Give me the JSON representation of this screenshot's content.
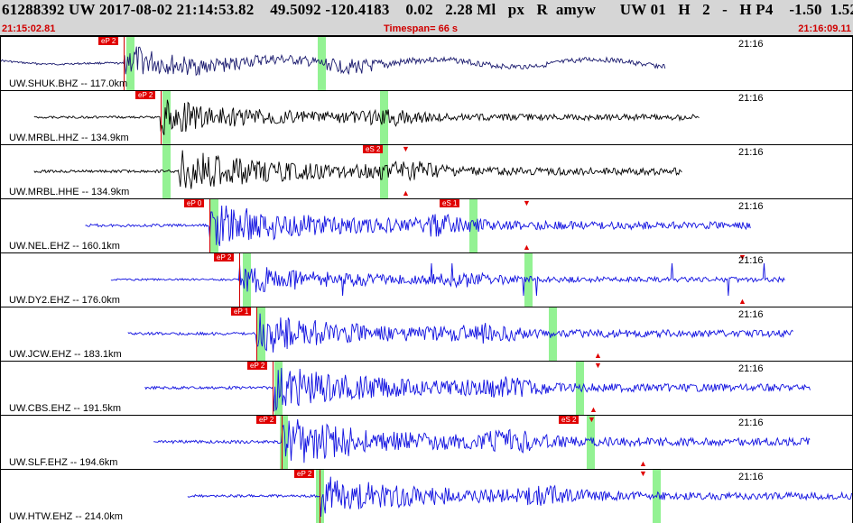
{
  "header": {
    "title": "61288392 UW 2017-08-02 21:14:53.82    49.5092 -120.4183    0.02   2.28 Ml   px   R  amyw      UW 01   H   2   -   H P4    -1.50  1.52",
    "start_time": "21:15:02.81",
    "timespan": "Timespan=  66 s",
    "end_time": "21:16:09.11"
  },
  "colors": {
    "header_bg": "#d6d6d6",
    "navy": "#1a1a6e",
    "black": "#000000",
    "blue": "#1010e0",
    "pick": "#e00000",
    "window": "#80f080"
  },
  "panels": [
    {
      "station": "UW.SHUK.BHZ -- 117.0km",
      "time_label": "21:16",
      "trace_color": "navy",
      "style": "long",
      "signal": {
        "start": 0.0,
        "end": 0.78,
        "onset": 0.145,
        "amp": 0.3
      },
      "picks": [
        {
          "label": "eP 2",
          "pos": 0.145,
          "line": true
        }
      ],
      "windows": [
        0.148,
        0.372
      ],
      "triangles": []
    },
    {
      "station": "UW.MRBL.HHZ -- 134.9km",
      "time_label": "21:16",
      "trace_color": "black",
      "style": "burst",
      "signal": {
        "start": 0.04,
        "end": 0.82,
        "onset": 0.188,
        "amp": 0.35
      },
      "picks": [
        {
          "label": "eP 2",
          "pos": 0.188,
          "line": true
        }
      ],
      "windows": [
        0.19,
        0.445
      ],
      "triangles": []
    },
    {
      "station": "UW.MRBL.HHE -- 134.9km",
      "time_label": "21:16",
      "trace_color": "black",
      "style": "burst",
      "signal": {
        "start": 0.04,
        "end": 0.8,
        "onset": 0.21,
        "amp": 0.42
      },
      "picks": [
        {
          "label": "eS 2",
          "pos": 0.455,
          "line": false
        }
      ],
      "windows": [
        0.19,
        0.445
      ],
      "triangles": [
        {
          "pos": 0.475,
          "top": true
        },
        {
          "pos": 0.475,
          "top": false
        }
      ]
    },
    {
      "station": "UW.NEL.EHZ -- 160.1km",
      "time_label": "21:16",
      "trace_color": "blue",
      "style": "burst",
      "signal": {
        "start": 0.1,
        "end": 0.88,
        "onset": 0.245,
        "amp": 0.45
      },
      "picks": [
        {
          "label": "eP 0",
          "pos": 0.245,
          "line": true
        },
        {
          "label": "eS 1",
          "pos": 0.545,
          "line": false
        }
      ],
      "windows": [
        0.247,
        0.55
      ],
      "triangles": [
        {
          "pos": 0.617,
          "top": true
        },
        {
          "pos": 0.617,
          "top": false
        }
      ]
    },
    {
      "station": "UW.DY2.EHZ -- 176.0km",
      "time_label": "21:16",
      "trace_color": "blue",
      "style": "spiky",
      "signal": {
        "start": 0.13,
        "end": 0.92,
        "onset": 0.28,
        "amp": 0.3
      },
      "picks": [
        {
          "label": "eP 2",
          "pos": 0.28,
          "line": true
        }
      ],
      "windows": [
        0.285,
        0.615
      ],
      "triangles": [
        {
          "pos": 0.87,
          "top": true
        },
        {
          "pos": 0.87,
          "top": false
        }
      ]
    },
    {
      "station": "UW.JCW.EHZ -- 183.1km",
      "time_label": "21:16",
      "trace_color": "blue",
      "style": "burst",
      "signal": {
        "start": 0.15,
        "end": 0.93,
        "onset": 0.3,
        "amp": 0.42
      },
      "picks": [
        {
          "label": "eP 1",
          "pos": 0.3,
          "line": true
        }
      ],
      "windows": [
        0.302,
        0.643
      ],
      "triangles": [
        {
          "pos": 0.7,
          "top": false
        }
      ]
    },
    {
      "station": "UW.CBS.EHZ -- 191.5km",
      "time_label": "21:16",
      "trace_color": "blue",
      "style": "burst",
      "signal": {
        "start": 0.17,
        "end": 0.95,
        "onset": 0.32,
        "amp": 0.45
      },
      "picks": [
        {
          "label": "eP 2",
          "pos": 0.32,
          "line": true
        }
      ],
      "windows": [
        0.322,
        0.675
      ],
      "triangles": [
        {
          "pos": 0.7,
          "top": true
        },
        {
          "pos": 0.695,
          "top": false
        }
      ]
    },
    {
      "station": "UW.SLF.EHZ -- 194.6km",
      "time_label": "21:16",
      "trace_color": "blue",
      "style": "burst",
      "signal": {
        "start": 0.18,
        "end": 0.95,
        "onset": 0.33,
        "amp": 0.48
      },
      "picks": [
        {
          "label": "eP 2",
          "pos": 0.33,
          "line": true
        },
        {
          "label": "eS 2",
          "pos": 0.685,
          "line": false
        }
      ],
      "windows": [
        0.328,
        0.688
      ],
      "triangles": [
        {
          "pos": 0.693,
          "top": true
        },
        {
          "pos": 0.753,
          "top": false
        }
      ]
    },
    {
      "station": "UW.HTW.EHZ -- 214.0km",
      "time_label": "21:16",
      "trace_color": "blue",
      "style": "burst",
      "signal": {
        "start": 0.22,
        "end": 1.0,
        "onset": 0.375,
        "amp": 0.42
      },
      "picks": [
        {
          "label": "eP 2",
          "pos": 0.375,
          "line": true
        }
      ],
      "windows": [
        0.37,
        0.765
      ],
      "triangles": [
        {
          "pos": 0.753,
          "top": true
        }
      ]
    }
  ]
}
